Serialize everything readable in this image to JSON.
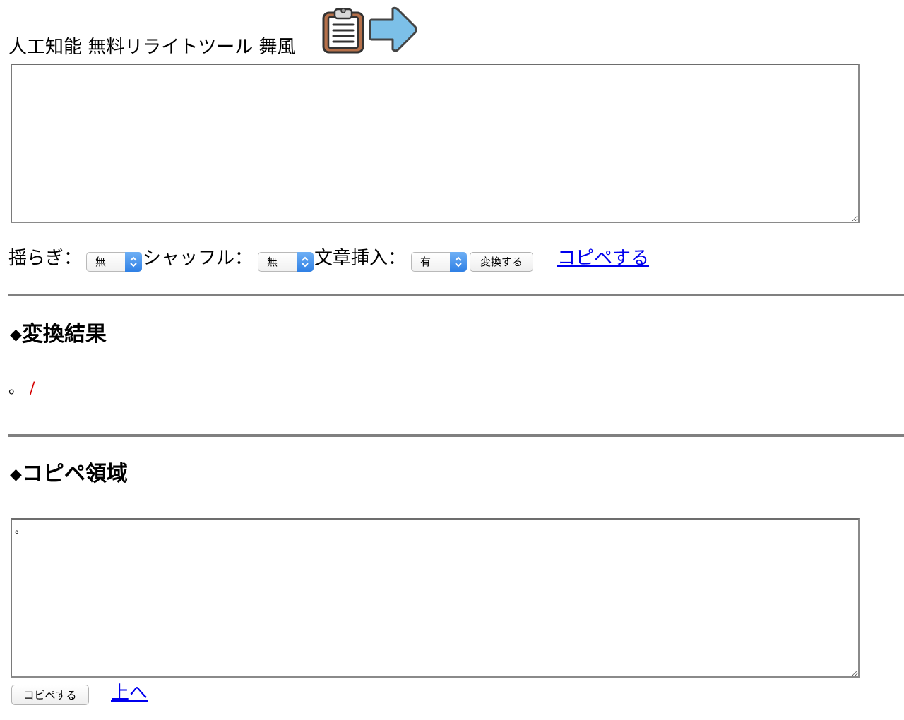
{
  "header": {
    "title": "人工知能 無料リライトツール 舞風",
    "clipboard_icon": "clipboard-icon",
    "arrow_icon": "arrow-right-icon",
    "arrow_color": "#7cc0e8",
    "clipboard_color": "#b5704a"
  },
  "input": {
    "value": ""
  },
  "controls": {
    "fluctuation_label": "揺らぎ：",
    "fluctuation_value": "無",
    "shuffle_label": "シャッフル：",
    "shuffle_value": "無",
    "insert_label": "文章挿入：",
    "insert_value": "有",
    "convert_button": "変換する",
    "copy_link": "コピペする"
  },
  "result_section": {
    "heading_marker": "◆",
    "heading": "変換結果",
    "result_text": "。",
    "result_separator": "/"
  },
  "copy_section": {
    "heading_marker": "◆",
    "heading": "コピペ領域",
    "value": "。",
    "copy_button": "コピペする",
    "top_link": "上へ"
  }
}
